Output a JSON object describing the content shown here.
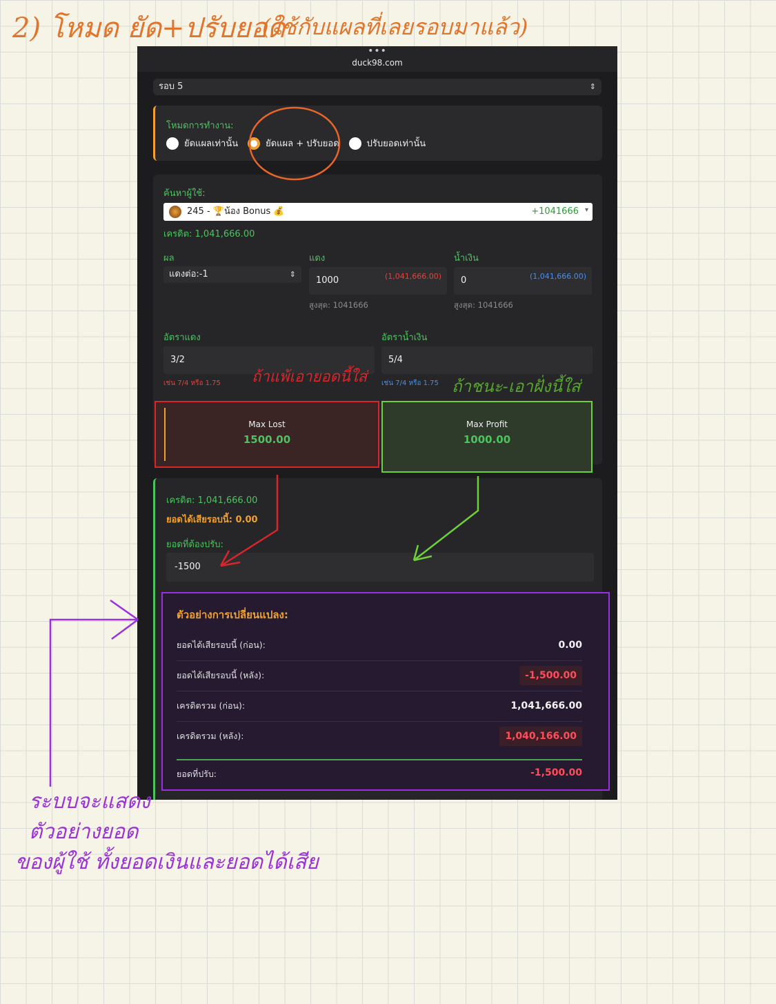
{
  "annotations": {
    "title": "2) โหมด ยัด+ปรับยอด",
    "subtitle": "(ใช้กับแผลที่เลยรอบมาแล้ว)",
    "red_note": "ถ้าแพ้เอายอดนี้ใส่",
    "green_note": "ถ้าชนะ-เอาฝั่งนี้ใส่",
    "bottom_note": [
      "ระบบจะแสดง",
      "ตัวอย่างยอด",
      "ของผู้ใช้ ทั้งยอดเงินและยอดได้เสีย"
    ]
  },
  "browser": {
    "dots": "•••",
    "url": "duck98.com"
  },
  "round_select": {
    "value": "รอบ 5"
  },
  "mode": {
    "label": "โหมดการทำงาน:",
    "options": [
      "ยัดแผลเท่านั้น",
      "ยัดแผล + ปรับยอด",
      "ปรับยอดเท่านั้น"
    ],
    "selected": "ยัดแผล + ปรับยอด"
  },
  "user_search": {
    "label": "ค้นหาผู้ใช้:",
    "selected_text": "245 - 🏆น้อง Bonus 💰",
    "selected_amount": "+1041666",
    "credit": "เครดิต: 1,041,666.00"
  },
  "bet": {
    "result_label": "ผล",
    "result_value": "แดงต่อ:-1",
    "red_label": "แดง",
    "red_value": "1000",
    "red_paren": "(1,041,666.00)",
    "red_max": "สูงสุด: 1041666",
    "blue_label": "น้ำเงิน",
    "blue_value": "0",
    "blue_paren": "(1,041,666.00)",
    "blue_max": "สูงสุด: 1041666",
    "red_rate_label": "อัตราแดง",
    "red_rate_value": "3/2",
    "red_rate_hint": "เช่น 7/4 หรือ 1.75",
    "blue_rate_label": "อัตราน้ำเงิน",
    "blue_rate_value": "5/4",
    "blue_rate_hint": "เช่น 7/4 หรือ 1.75"
  },
  "summary": {
    "max_lost_label": "Max Lost",
    "max_lost_value": "1500.00",
    "max_profit_label": "Max Profit",
    "max_profit_value": "1000.00"
  },
  "result": {
    "credit": "เครดิต: 1,041,666.00",
    "round_pl": "ยอดได้เสียรอบนี้: 0.00",
    "adjust_label": "ยอดที่ต้องปรับ:",
    "adjust_value": "-1500"
  },
  "preview": {
    "title": "ตัวอย่างการเปลี่ยนแปลง:",
    "rows": [
      {
        "label": "ยอดได้เสียรอบนี้ (ก่อน):",
        "value": "0.00"
      },
      {
        "label": "ยอดได้เสียรอบนี้ (หลัง):",
        "value": "-1,500.00"
      },
      {
        "label": "เครดิตรวม (ก่อน):",
        "value": "1,041,666.00"
      },
      {
        "label": "เครดิตรวม (หลัง):",
        "value": "1,040,166.00"
      }
    ],
    "final_label": "ยอดที่ปรับ:",
    "final_value": "-1,500.00"
  },
  "colors": {
    "accent_orange": "#f0a130",
    "green": "#4fc260",
    "red": "#ff4d5a",
    "purple_frame": "#9b30e0"
  }
}
